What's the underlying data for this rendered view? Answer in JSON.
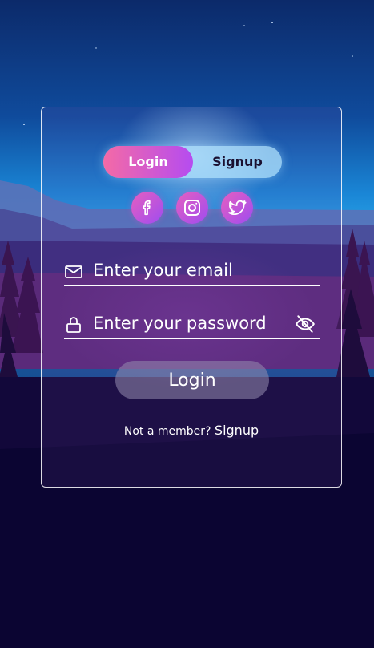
{
  "tabs": {
    "login": "Login",
    "signup": "Signup"
  },
  "social": [
    "facebook-icon",
    "instagram-icon",
    "twitter-icon"
  ],
  "email": {
    "placeholder": "Enter your email",
    "value": ""
  },
  "password": {
    "placeholder": "Enter your password",
    "value": ""
  },
  "login_button": "Login",
  "footer": {
    "text": "Not a member?",
    "link": "Signup"
  },
  "colors": {
    "accent_start": "#f46aa6",
    "accent_end": "#b54cf0",
    "background": "#0b0532"
  }
}
